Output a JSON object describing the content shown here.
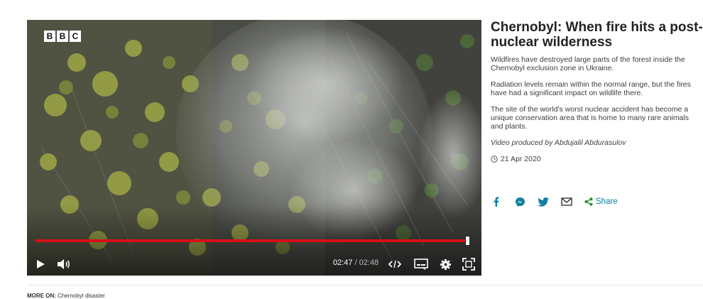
{
  "video": {
    "logo_letters": [
      "B",
      "B",
      "C"
    ],
    "current_time": "02:47",
    "separator": " / ",
    "total_time": "02:48",
    "progress_fraction": 0.994,
    "colors": {
      "progress": "#d51017",
      "controls": "#ffffff"
    },
    "icons": [
      "play-icon",
      "volume-icon",
      "embed-icon",
      "subtitles-icon",
      "settings-icon",
      "fullscreen-icon"
    ]
  },
  "article": {
    "title": "Chernobyl: When fire hits a post-nuclear wilderness",
    "paragraphs": [
      "Wildfires have destroyed large parts of the forest inside the Chernobyl exclusion zone in Ukraine.",
      "Radiation levels remain within the normal range, but the fires have had a significant impact on wildlife there.",
      "The site of the world's worst nuclear accident has become a unique conservation area that is home to many rare animals and plants."
    ],
    "credit": "Video produced by Abdujalil Abdurasulov",
    "date": "21 Apr 2020"
  },
  "share": {
    "label": "Share",
    "icons": [
      "facebook-icon",
      "messenger-icon",
      "twitter-icon",
      "email-icon",
      "share-icon"
    ],
    "color": "#1380a1"
  },
  "more_on": {
    "label": "MORE ON:",
    "topic": "Chernobyl disaster"
  }
}
